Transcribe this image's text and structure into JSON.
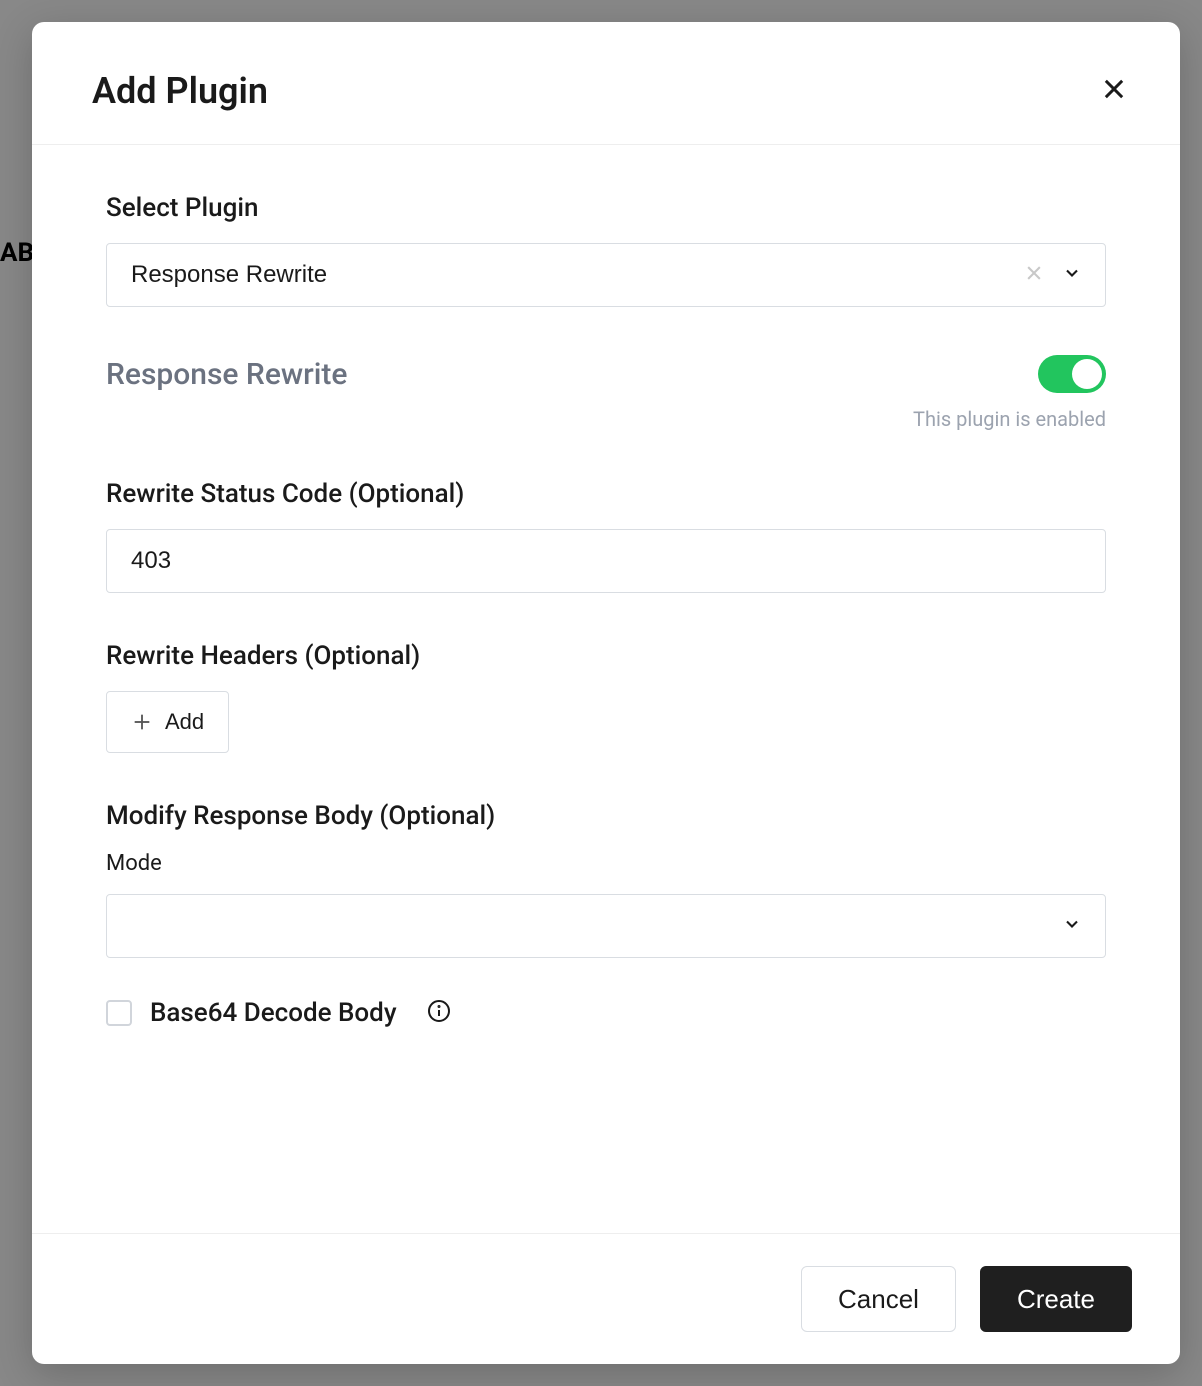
{
  "backdrop": {
    "partial_text": "AB"
  },
  "modal": {
    "title": "Add Plugin",
    "footer": {
      "cancel": "Cancel",
      "create": "Create"
    }
  },
  "form": {
    "select_plugin": {
      "label": "Select Plugin",
      "value": "Response Rewrite"
    },
    "plugin_toggle": {
      "name": "Response Rewrite",
      "enabled": true,
      "caption": "This plugin is enabled"
    },
    "status_code": {
      "label": "Rewrite Status Code (Optional)",
      "value": "403"
    },
    "headers": {
      "label": "Rewrite Headers (Optional)",
      "add_button": "Add"
    },
    "body": {
      "label": "Modify Response Body (Optional)",
      "mode_label": "Mode",
      "mode_value": ""
    },
    "base64": {
      "label": "Base64 Decode Body",
      "checked": false
    }
  }
}
